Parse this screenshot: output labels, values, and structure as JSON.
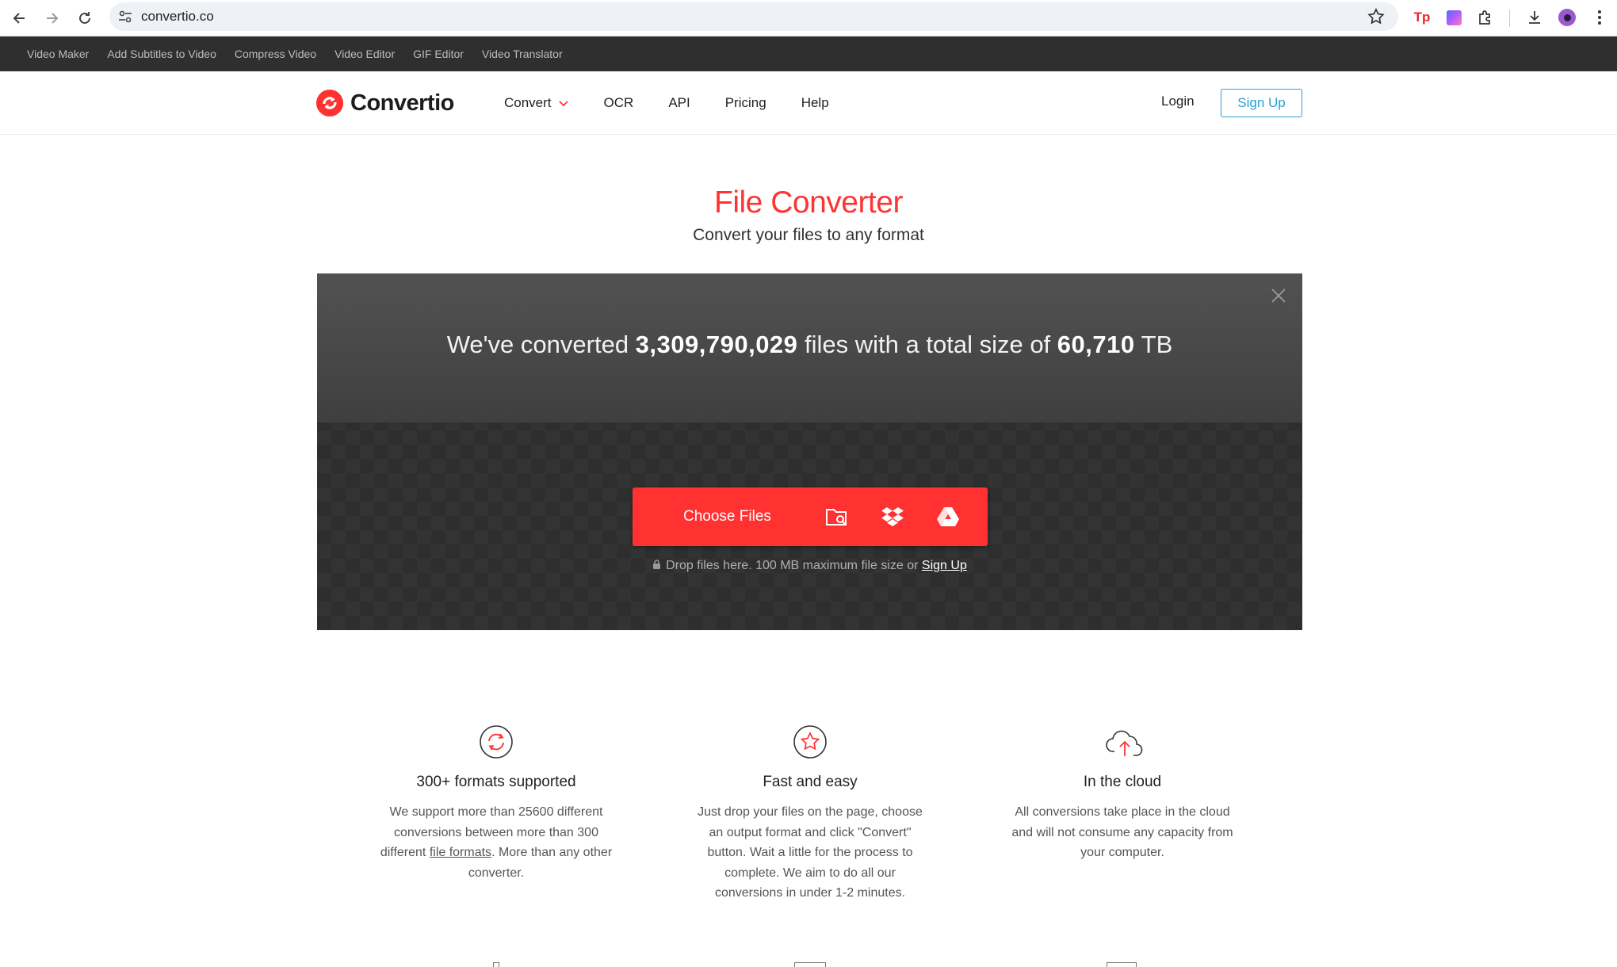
{
  "browser": {
    "url": "convertio.co",
    "icons": [
      "back-icon",
      "forward-icon",
      "reload-icon",
      "site-info-icon",
      "bookmark-star-icon",
      "extension-tp-icon",
      "extension-gradient-icon",
      "extensions-puzzle-icon",
      "downloads-icon",
      "profile-avatar",
      "more-menu-icon"
    ],
    "ext_tp_label": "Tp"
  },
  "topbar": {
    "links": [
      "Video Maker",
      "Add Subtitles to Video",
      "Compress Video",
      "Video Editor",
      "GIF Editor",
      "Video Translator"
    ]
  },
  "header": {
    "logo_text": "Convertio",
    "nav": [
      "Convert",
      "OCR",
      "API",
      "Pricing",
      "Help"
    ],
    "login": "Login",
    "signup": "Sign Up"
  },
  "hero": {
    "title": "File Converter",
    "subtitle": "Convert your files to any format"
  },
  "panel": {
    "stats_prefix": "We've converted ",
    "files_count": "3,309,790,029",
    "stats_middle": " files with a total size of ",
    "total_size": "60,710",
    "stats_suffix": " TB",
    "choose_files": "Choose Files",
    "drop_note": "Drop files here. 100 MB maximum file size or ",
    "drop_signup": "Sign Up"
  },
  "features": [
    {
      "icon": "convert-arrows-icon",
      "title": "300+ formats supported",
      "text_before": "We support more than 25600 different conversions between more than 300 different ",
      "link": "file formats",
      "text_after": ". More than any other converter."
    },
    {
      "icon": "star-icon",
      "title": "Fast and easy",
      "text": "Just drop your files on the page, choose an output format and click \"Convert\" button. Wait a little for the process to complete. We aim to do all our conversions in under 1-2 minutes."
    },
    {
      "icon": "cloud-upload-icon",
      "title": "In the cloud",
      "text": "All conversions take place in the cloud and will not consume any capacity from your computer."
    }
  ],
  "colors": {
    "brand_red": "#ff3131",
    "signup_blue": "#2a9fd6",
    "topbar": "#2f2f2f",
    "panel_dark": "#2e2e2e"
  }
}
